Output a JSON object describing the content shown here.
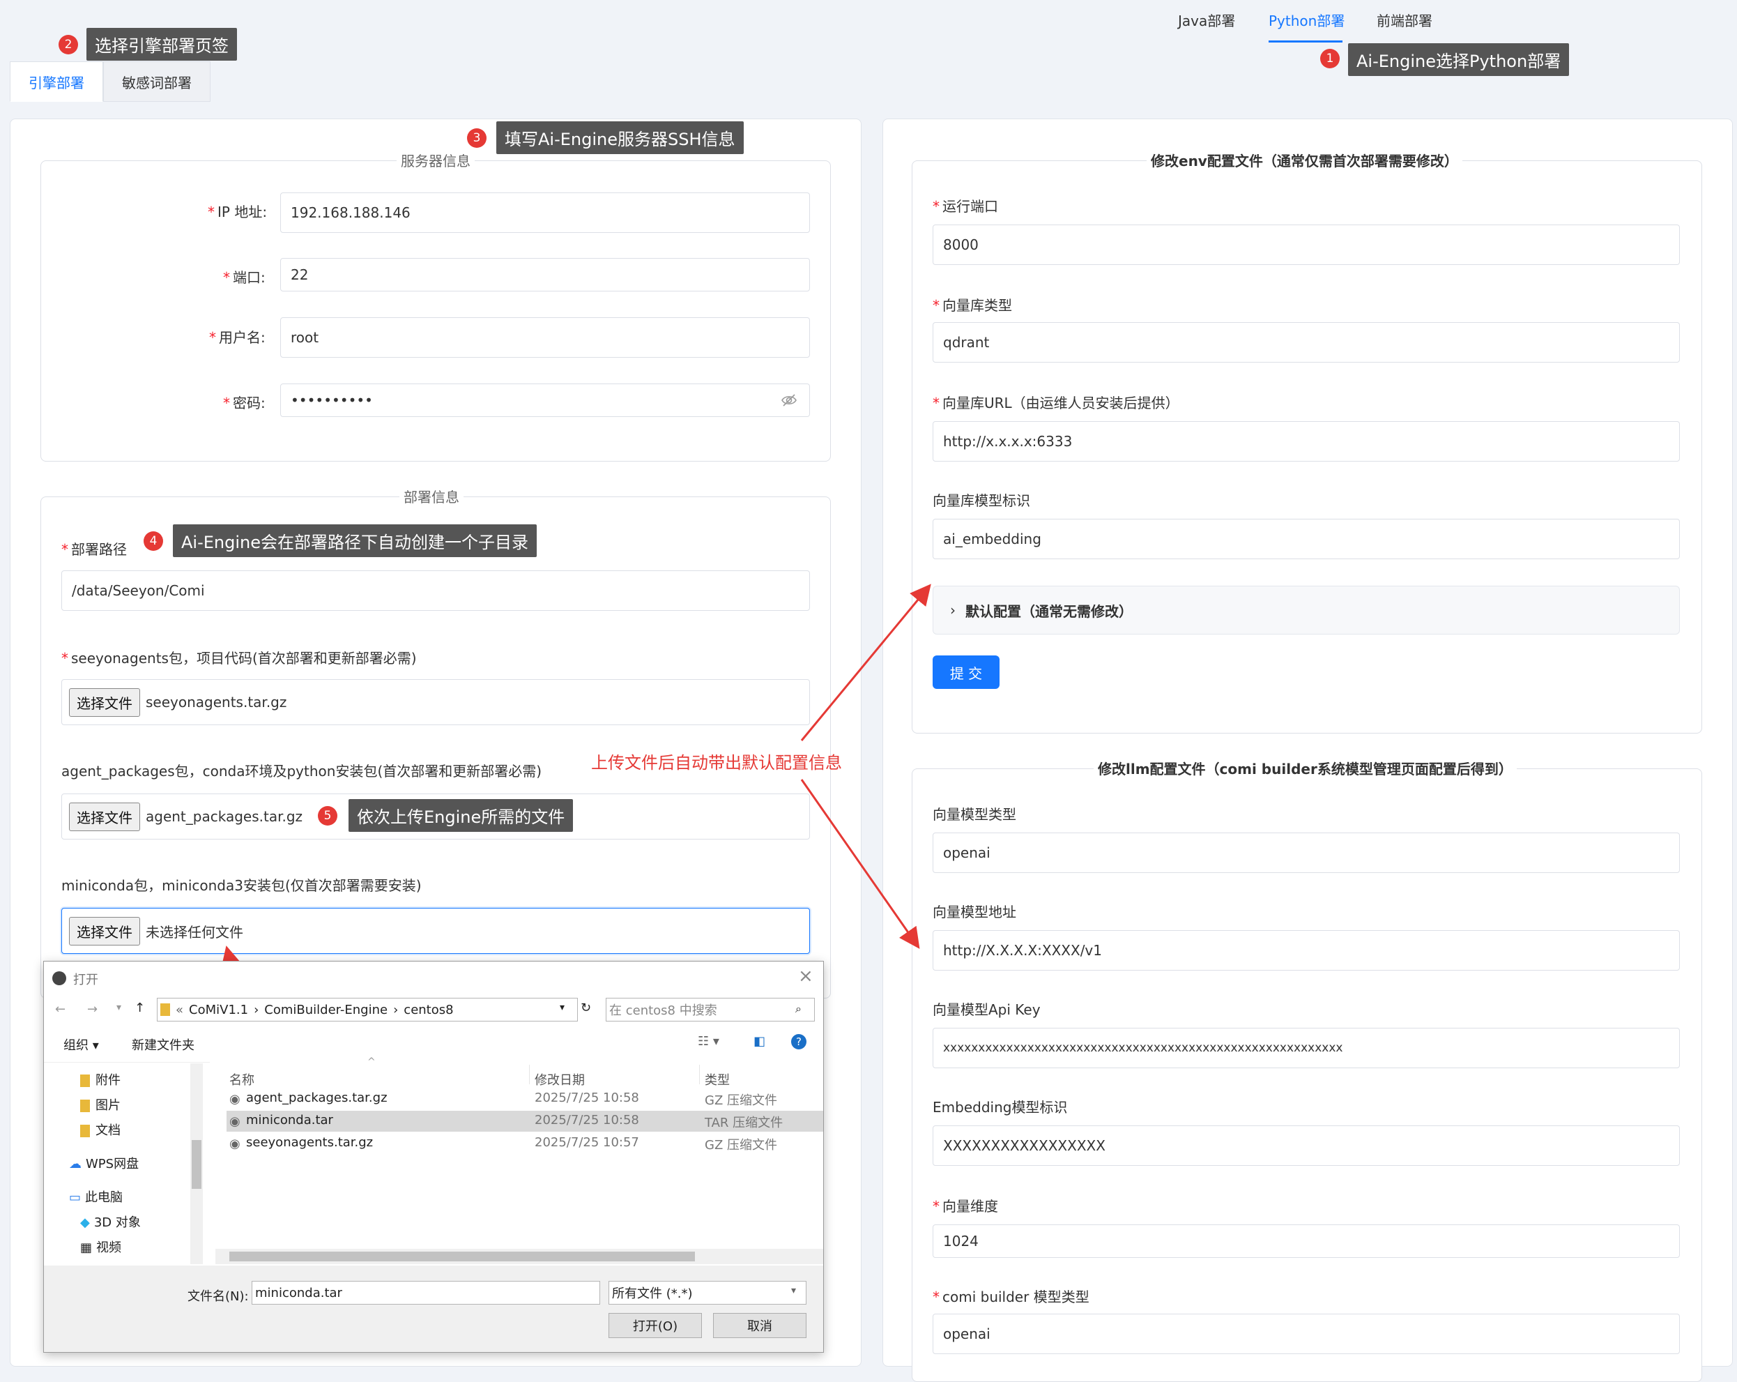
{
  "top_tabs": [
    "Java部署",
    "Python部署",
    "前端部署"
  ],
  "sub_tabs": [
    "引擎部署",
    "敏感词部署"
  ],
  "annotations": {
    "a1": {
      "num": "1",
      "text": "Ai-Engine选择Python部署"
    },
    "a2": {
      "num": "2",
      "text": "选择引擎部署页签"
    },
    "a3": {
      "num": "3",
      "text": "填写Ai-Engine服务器SSH信息"
    },
    "a4": {
      "num": "4",
      "text": "Ai-Engine会在部署路径下自动创建一个子目录"
    },
    "a5": {
      "num": "5",
      "text": "依次上传Engine所需的文件"
    },
    "red_note": "上传文件后自动带出默认配置信息"
  },
  "server": {
    "legend": "服务器信息",
    "ip_label": "IP 地址:",
    "ip": "192.168.188.146",
    "port_label": "端口:",
    "port": "22",
    "user_label": "用户名:",
    "user": "root",
    "pwd_label": "密码:",
    "pwd": "••••••••••"
  },
  "deploy": {
    "legend": "部署信息",
    "path_label": "部署路径",
    "path": "/data/Seeyon/Comi",
    "pkg1_label": "seeyonagents包，项目代码(首次部署和更新部署必需)",
    "pkg1_file": "seeyonagents.tar.gz",
    "pkg2_label": "agent_packages包，conda环境及python安装包(首次部署和更新部署必需)",
    "pkg2_file": "agent_packages.tar.gz",
    "pkg3_label": "miniconda包，miniconda3安装包(仅首次部署需要安装)",
    "pkg3_file": "未选择任何文件",
    "choose_btn": "选择文件"
  },
  "env": {
    "legend": "修改env配置文件（通常仅需首次部署需要修改）",
    "port_label": "运行端口",
    "port": "8000",
    "vdb_type_label": "向量库类型",
    "vdb_type": "qdrant",
    "vdb_url_label": "向量库URL（由运维人员安装后提供）",
    "vdb_url": "http://x.x.x.x:6333",
    "vdb_model_label": "向量库模型标识",
    "vdb_model": "ai_embedding",
    "collapse": "默认配置（通常无需修改）",
    "submit": "提 交"
  },
  "llm": {
    "legend": "修改llm配置文件（comi builder系统模型管理页面配置后得到）",
    "vm_type_label": "向量模型类型",
    "vm_type": "openai",
    "vm_addr_label": "向量模型地址",
    "vm_addr": "http://X.X.X.X:XXXX/v1",
    "vm_key_label": "向量模型Api Key",
    "vm_key": "xxxxxxxxxxxxxxxxxxxxxxxxxxxxxxxxxxxxxxxxxxxxxxxxxxxxxxxxx",
    "emb_label": "Embedding模型标识",
    "emb": "XXXXXXXXXXXXXXXXX",
    "dim_label": "向量维度",
    "dim": "1024",
    "comi_type_label": "comi builder 模型类型",
    "comi_type": "openai"
  },
  "dialog": {
    "title": "打开",
    "breadcrumb": [
      "CoMiV1.1",
      "ComiBuilder-Engine",
      "centos8"
    ],
    "search_placeholder": "在 centos8 中搜索",
    "organize": "组织",
    "new_folder": "新建文件夹",
    "nav": [
      "附件",
      "图片",
      "文档",
      "WPS网盘",
      "此电脑",
      "3D 对象",
      "视频"
    ],
    "cols": [
      "名称",
      "修改日期",
      "类型"
    ],
    "files": [
      {
        "name": "agent_packages.tar.gz",
        "date": "2025/7/25 10:58",
        "type": "GZ 压缩文件"
      },
      {
        "name": "miniconda.tar",
        "date": "2025/7/25 10:58",
        "type": "TAR 压缩文件"
      },
      {
        "name": "seeyonagents.tar.gz",
        "date": "2025/7/25 10:57",
        "type": "GZ 压缩文件"
      }
    ],
    "filename_label": "文件名(N):",
    "filename": "miniconda.tar",
    "filter": "所有文件 (*.*)",
    "open_btn": "打开(O)",
    "cancel_btn": "取消"
  }
}
